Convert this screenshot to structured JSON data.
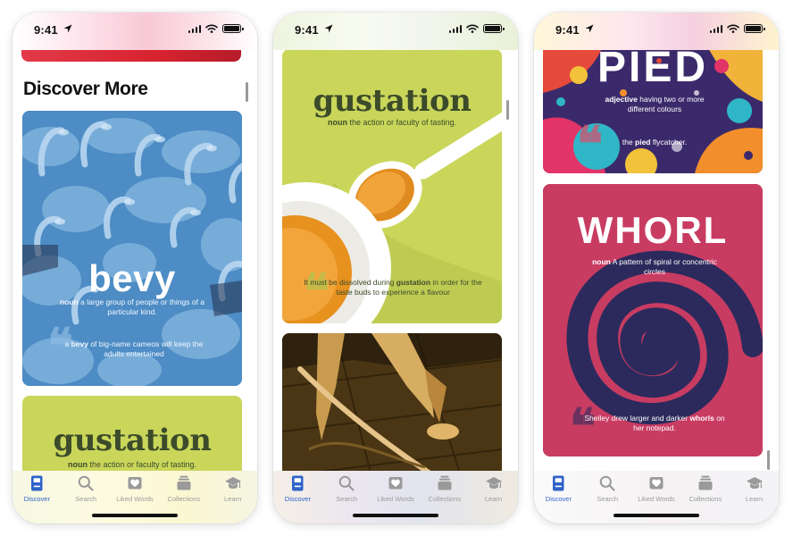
{
  "status_bar": {
    "time": "9:41"
  },
  "tabbar": {
    "items": [
      {
        "id": "discover",
        "label": "Discover",
        "icon": "book-icon"
      },
      {
        "id": "search",
        "label": "Search",
        "icon": "search-icon"
      },
      {
        "id": "liked",
        "label": "Liked Words",
        "icon": "heart-icon"
      },
      {
        "id": "collections",
        "label": "Collections",
        "icon": "collections-icon"
      },
      {
        "id": "learn",
        "label": "Learn",
        "icon": "graduation-cap-icon"
      }
    ],
    "active": "discover"
  },
  "phone1": {
    "section_title": "Discover More",
    "bevy": {
      "word": "bevy",
      "pos": "noun",
      "definition": "a large group of people or things of a particular kind.",
      "example_pre": "a ",
      "example_word": "bevy",
      "example_post": " of big-name cameos will keep the adults entertained"
    },
    "gustation": {
      "word": "gustation",
      "pos": "noun",
      "definition": "the action or faculty of tasting."
    }
  },
  "phone2": {
    "gustation": {
      "word": "gustation",
      "pos": "noun",
      "definition": "the action or faculty of tasting.",
      "example_pre": "It must be dissolved during ",
      "example_word": "gustation",
      "example_post": " in order for the taste buds to experience a flavour"
    }
  },
  "phone3": {
    "pied": {
      "word": "PIED",
      "pos": "adjective",
      "definition": "having two or more different colours",
      "example_pre": "the ",
      "example_word": "pied",
      "example_post": " flycatcher."
    },
    "whorl": {
      "word": "WHORL",
      "pos": "noun",
      "definition": "A pattern of spiral or concentric circles",
      "example_pre": "Shelley drew larger and darker ",
      "example_word": "whorls",
      "example_post": " on her notepad."
    }
  },
  "colors": {
    "active_tab": "#2f63c9",
    "inactive_tab": "#9a9a9a",
    "bevy_blue": "#4d8cc4",
    "gustation_green": "#c9d65a",
    "gustation_text": "#3c4b2a",
    "whorl_pink": "#c83c62",
    "whorl_navy": "#2c2a5c",
    "pied_purple": "#3b2a6b"
  }
}
